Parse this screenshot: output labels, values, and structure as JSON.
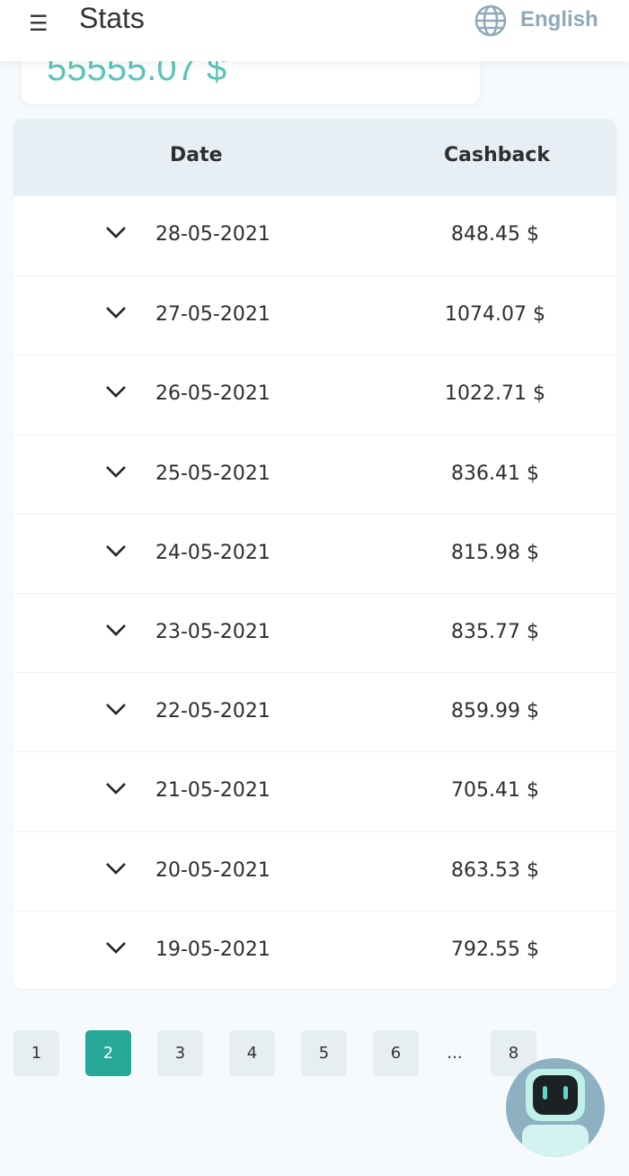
{
  "header": {
    "title": "Stats",
    "language": "English",
    "menu_icon": "hamburger-icon",
    "globe_icon": "globe-icon"
  },
  "summary": {
    "total": "55555.07 $"
  },
  "table": {
    "headers": {
      "date": "Date",
      "cashback": "Cashback"
    },
    "rows": [
      {
        "date": "28-05-2021",
        "cashback": "848.45 $"
      },
      {
        "date": "27-05-2021",
        "cashback": "1074.07 $"
      },
      {
        "date": "26-05-2021",
        "cashback": "1022.71 $"
      },
      {
        "date": "25-05-2021",
        "cashback": "836.41 $"
      },
      {
        "date": "24-05-2021",
        "cashback": "815.98 $"
      },
      {
        "date": "23-05-2021",
        "cashback": "835.77 $"
      },
      {
        "date": "22-05-2021",
        "cashback": "859.99 $"
      },
      {
        "date": "21-05-2021",
        "cashback": "705.41 $"
      },
      {
        "date": "20-05-2021",
        "cashback": "863.53 $"
      },
      {
        "date": "19-05-2021",
        "cashback": "792.55 $"
      }
    ]
  },
  "pagination": {
    "pages": [
      "1",
      "2",
      "3",
      "4",
      "5",
      "6"
    ],
    "ellipsis": "...",
    "last": "8",
    "current": "2",
    "accent": "#26a899"
  },
  "assistant": {
    "icon": "robot-assistant-icon"
  }
}
